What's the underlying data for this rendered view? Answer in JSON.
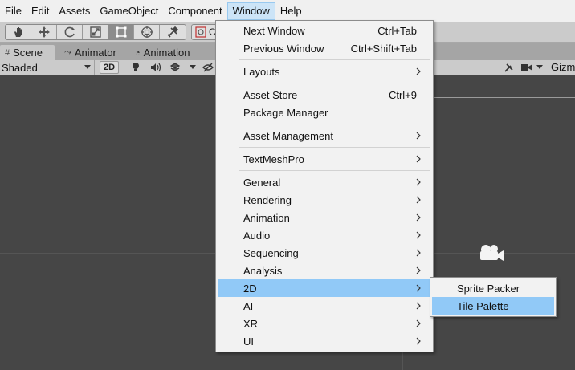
{
  "menubar": {
    "items": [
      "File",
      "Edit",
      "Assets",
      "GameObject",
      "Component",
      "Window",
      "Help"
    ],
    "active": "Window"
  },
  "toolbar": {
    "tools": [
      "hand-tool-icon",
      "move-tool-icon",
      "rotate-tool-icon",
      "scale-tool-icon",
      "rect-tool-icon",
      "transform-tool-icon",
      "custom-tool-icon"
    ],
    "active_tool": "rect-tool-icon",
    "pivot_label": "C"
  },
  "tabs": [
    {
      "label": "Scene",
      "icon": "#"
    },
    {
      "label": "Animator",
      "icon": "⤳"
    },
    {
      "label": "Animation",
      "icon": "◔"
    }
  ],
  "scene_toolbar": {
    "shading_mode": "Shaded",
    "mode_2d_label": "2D",
    "gizmos_label": "Gizmo"
  },
  "window_menu": {
    "items": [
      {
        "label": "Next Window",
        "shortcut": "Ctrl+Tab"
      },
      {
        "label": "Previous Window",
        "shortcut": "Ctrl+Shift+Tab"
      },
      {
        "label": "Layouts",
        "submenu": true
      },
      {
        "label": "Asset Store",
        "shortcut": "Ctrl+9"
      },
      {
        "label": "Package Manager"
      },
      {
        "label": "Asset Management",
        "submenu": true
      },
      {
        "label": "TextMeshPro",
        "submenu": true
      },
      {
        "label": "General",
        "submenu": true
      },
      {
        "label": "Rendering",
        "submenu": true
      },
      {
        "label": "Animation",
        "submenu": true
      },
      {
        "label": "Audio",
        "submenu": true
      },
      {
        "label": "Sequencing",
        "submenu": true
      },
      {
        "label": "Analysis",
        "submenu": true
      },
      {
        "label": "2D",
        "submenu": true,
        "highlighted": true
      },
      {
        "label": "AI",
        "submenu": true
      },
      {
        "label": "XR",
        "submenu": true
      },
      {
        "label": "UI",
        "submenu": true
      }
    ]
  },
  "submenu_2d": {
    "items": [
      {
        "label": "Sprite Packer"
      },
      {
        "label": "Tile Palette",
        "highlighted": true
      }
    ]
  },
  "colors": {
    "menu_highlight": "#91c9f7",
    "scene_background": "#464646",
    "menubar_background": "#f0f0f0"
  }
}
